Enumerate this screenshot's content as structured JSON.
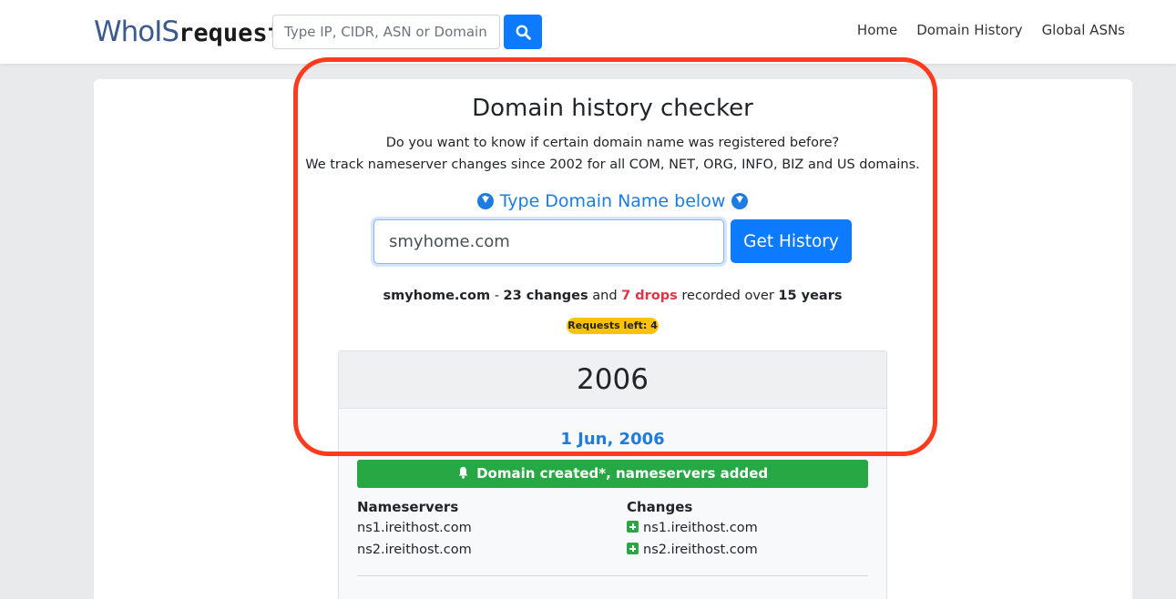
{
  "navbar": {
    "logo_part1": "WhoIS",
    "logo_part2": "request",
    "search_placeholder": "Type IP, CIDR, ASN or Domain..",
    "links": [
      "Home",
      "Domain History",
      "Global ASNs"
    ]
  },
  "main": {
    "title": "Domain history checker",
    "subtitle_line1": "Do you want to know if certain domain name was registered before?",
    "subtitle_line2": "We track nameserver changes since 2002 for all COM, NET, ORG, INFO, BIZ and US domains.",
    "hint": "Type Domain Name below",
    "domain_value": "smyhome.com",
    "button_label": "Get History",
    "summary": {
      "domain": "smyhome.com",
      "sep": " - ",
      "changes": "23 changes",
      "and": " and ",
      "drops": "7 drops",
      "over": " recorded over ",
      "years": "15 years"
    },
    "requests_left": "Requests left: 4"
  },
  "history": {
    "year": "2006",
    "date": "1 Jun, 2006",
    "event": "Domain created*, nameservers added",
    "nameservers_header": "Nameservers",
    "changes_header": "Changes",
    "nameservers": [
      "ns1.ireithost.com",
      "ns2.ireithost.com"
    ],
    "changes": [
      "ns1.ireithost.com",
      "ns2.ireithost.com"
    ]
  },
  "colors": {
    "accent": "#0d7bff",
    "link_blue": "#1c7ce0",
    "success": "#28a745",
    "danger": "#dc3545",
    "warning": "#ffc107",
    "highlight": "#ff3b1f"
  }
}
